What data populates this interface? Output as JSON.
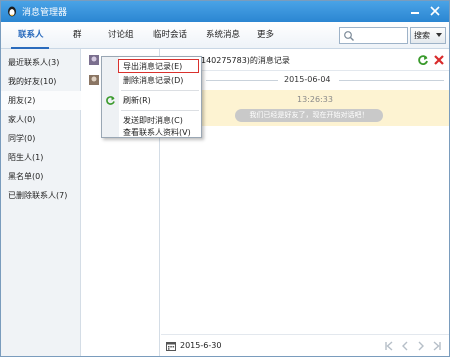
{
  "window": {
    "title": "消息管理器"
  },
  "toolbar": {
    "tabs": [
      {
        "label": "联系人",
        "active": true
      },
      {
        "label": "群",
        "active": false
      },
      {
        "label": "讨论组",
        "active": false
      },
      {
        "label": "临时会话",
        "active": false
      },
      {
        "label": "系统消息",
        "active": false
      },
      {
        "label": "更多",
        "active": false
      }
    ],
    "search": {
      "placeholder": "",
      "button_label": "搜索"
    }
  },
  "groups": [
    {
      "label": "最近联系人(3)"
    },
    {
      "label": "我的好友(10)"
    },
    {
      "label": "朋友(2)",
      "selected": true
    },
    {
      "label": "家人(0)"
    },
    {
      "label": "同学(0)"
    },
    {
      "label": "陌生人(1)"
    },
    {
      "label": "黑名单(0)"
    },
    {
      "label": "已删除联系人(7)"
    }
  ],
  "message_pane": {
    "title_suffix": "140275783)的消息记录",
    "date": "2015-06-04",
    "system_time": "13:26:33",
    "system_message": "我们已经是好友了，现在开始对话吧！",
    "footer_date": "2015-6-30"
  },
  "context_menu": {
    "items": [
      {
        "label": "导出消息记录(E)",
        "highlighted": true
      },
      {
        "label": "删除消息记录(D)"
      },
      {
        "label": "刷新(R)"
      },
      {
        "label": "发送即时消息(C)"
      },
      {
        "label": "查看联系人资料(V)"
      }
    ]
  },
  "colors": {
    "titlebar": "#2b86d2",
    "accent": "#2a6bbd",
    "system_row_bg": "#fdf3d2",
    "highlight_border": "#d9322e"
  }
}
